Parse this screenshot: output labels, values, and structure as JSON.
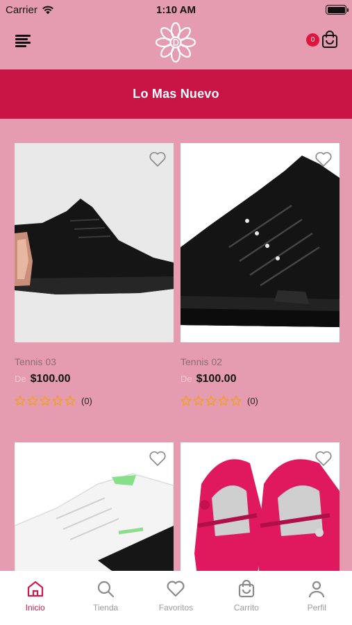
{
  "status_bar": {
    "carrier": "Carrier",
    "time": "1:10 AM"
  },
  "header": {
    "cart_count": "0"
  },
  "banner": {
    "title": "Lo Mas Nuevo"
  },
  "products": [
    {
      "name": "Tennis 03",
      "de": "De",
      "price": "$100.00",
      "rating_count": "(0)",
      "rating": 0
    },
    {
      "name": "Tennis 02",
      "de": "De",
      "price": "$100.00",
      "rating_count": "(0)",
      "rating": 0
    },
    {
      "name": "",
      "de": "",
      "price": "",
      "rating_count": ""
    },
    {
      "name": "",
      "de": "",
      "price": "",
      "rating_count": ""
    }
  ],
  "nav": {
    "items": [
      {
        "label": "Inicio",
        "icon": "home-icon",
        "active": true
      },
      {
        "label": "Tienda",
        "icon": "search-icon",
        "active": false
      },
      {
        "label": "Favoritos",
        "icon": "heart-icon",
        "active": false
      },
      {
        "label": "Carrito",
        "icon": "shopping-bag-icon",
        "active": false
      },
      {
        "label": "Perfil",
        "icon": "user-icon",
        "active": false
      }
    ]
  },
  "colors": {
    "background": "#e69cb0",
    "banner": "#c81545",
    "accent": "#d31850",
    "badge": "#e0143c",
    "star": "#f0a020"
  }
}
